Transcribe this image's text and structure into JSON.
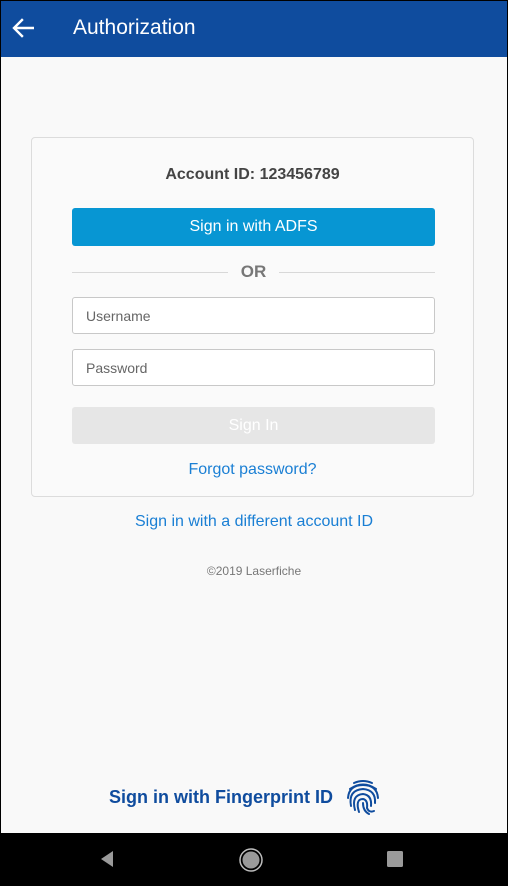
{
  "app_bar": {
    "title": "Authorization",
    "back_icon": "arrow-left-icon",
    "background_color": "#0f4c9e"
  },
  "card": {
    "account_id_label": "Account ID: 123456789",
    "adfs_button": "Sign in with ADFS",
    "adfs_color": "#0796d3",
    "divider_text": "OR",
    "username": {
      "value": "",
      "placeholder": "Username"
    },
    "password": {
      "value": "",
      "placeholder": "Password"
    },
    "signin_button": "Sign In",
    "signin_enabled": false,
    "forgot_password": "Forgot password?"
  },
  "different_account_link": "Sign in with a different account ID",
  "copyright": "©2019 Laserfiche",
  "fingerprint": {
    "label": "Sign in with Fingerprint ID",
    "icon": "fingerprint-icon"
  },
  "nav_bar": {
    "back_icon": "nav-back-triangle-icon",
    "home_icon": "nav-home-circle-icon",
    "recents_icon": "nav-recents-square-icon"
  }
}
